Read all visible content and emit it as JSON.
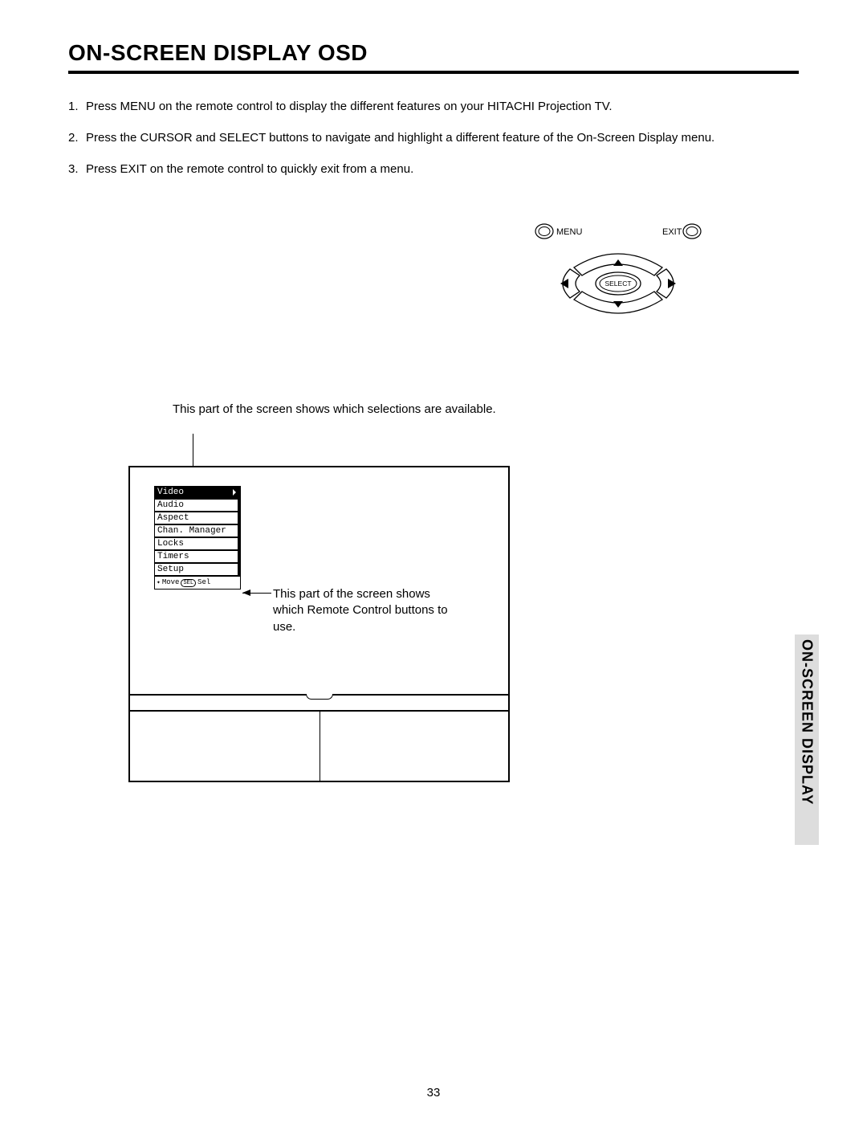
{
  "title": "ON-SCREEN DISPLAY OSD",
  "steps": [
    "Press MENU on the remote control to display the different features on your HITACHI Projection TV.",
    "Press the CURSOR and SELECT buttons to navigate and highlight a different feature of the On-Screen Display menu.",
    "Press EXIT on the remote control to quickly exit from a menu."
  ],
  "remote": {
    "menu": "MENU",
    "exit": "EXIT",
    "select": "SELECT"
  },
  "callout_top": "This part of the screen shows which selections are available.",
  "callout_right": "This part of the screen shows which Remote Control buttons to use.",
  "osd": {
    "items": [
      "Video",
      "Audio",
      "Aspect",
      "Chan. Manager",
      "Locks",
      "Timers",
      "Setup"
    ],
    "hint_move": "Move",
    "hint_sel_badge": "SEL",
    "hint_sel": "Sel"
  },
  "side_tab": "ON-SCREEN DISPLAY",
  "page_number": "33"
}
